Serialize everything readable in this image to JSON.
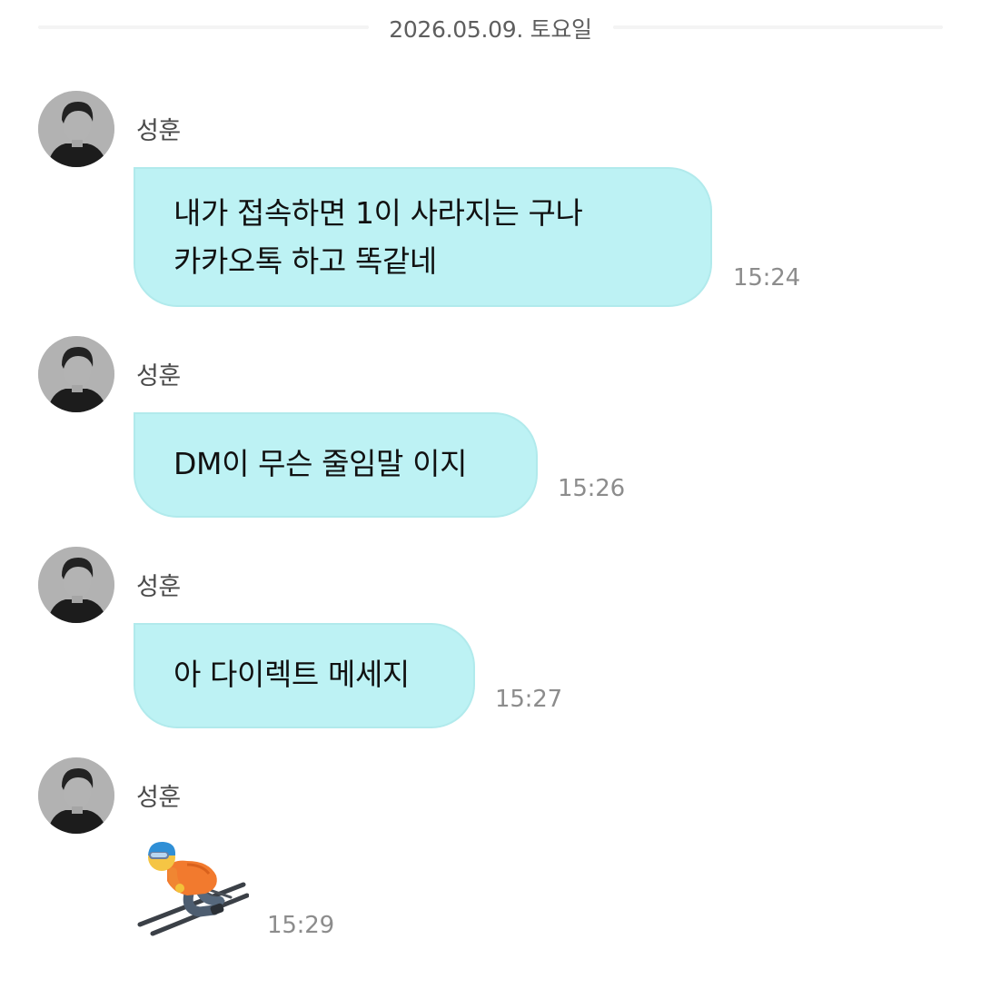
{
  "date_divider": "2026.05.09. 토요일",
  "messages": [
    {
      "sender": "성훈",
      "lines": [
        "내가 접속하면 1이 사라지는 구나",
        "카카오톡 하고 똑같네"
      ],
      "time": "15:24"
    },
    {
      "sender": "성훈",
      "lines": [
        "DM이 무슨 줄임말 이지"
      ],
      "time": "15:26"
    },
    {
      "sender": "성훈",
      "lines": [
        "아 다이렉트 메세지"
      ],
      "time": "15:27"
    },
    {
      "sender": "성훈",
      "emoji": "skier-emoji",
      "time": "15:29"
    }
  ],
  "colors": {
    "bubble": "#bdf2f4",
    "bubble_border": "#b1eaec",
    "time": "#8c8c8c",
    "sender": "#4a4a4a"
  }
}
